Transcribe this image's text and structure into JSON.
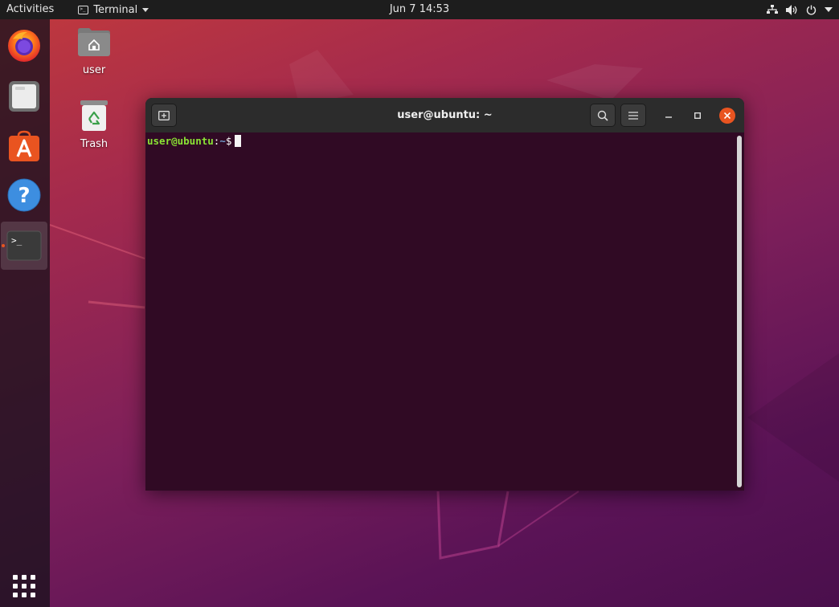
{
  "topbar": {
    "activities": "Activities",
    "app_menu_label": "Terminal",
    "clock": "Jun 7  14:53",
    "tray_icons": [
      "network-icon",
      "volume-icon",
      "power-icon",
      "chevron-down-icon"
    ]
  },
  "dock": {
    "items": [
      {
        "name": "firefox",
        "icon": "firefox-icon"
      },
      {
        "name": "files",
        "icon": "files-icon"
      },
      {
        "name": "ubuntu-software",
        "icon": "software-icon"
      },
      {
        "name": "help",
        "icon": "help-icon"
      },
      {
        "name": "terminal",
        "icon": "terminal-icon",
        "active": true
      }
    ],
    "show_apps_icon": "grid-icon"
  },
  "desktop": {
    "icons": [
      {
        "label": "user",
        "icon": "home-folder-icon"
      },
      {
        "label": "Trash",
        "icon": "trash-icon"
      }
    ]
  },
  "terminal": {
    "title": "user@ubuntu: ~",
    "prompt_user": "user@ubuntu",
    "prompt_sep": ":",
    "prompt_path": "~",
    "prompt_symbol": "$"
  },
  "colors": {
    "accent": "#e95420",
    "terminal_bg": "#300a24",
    "prompt_user": "#8ae234",
    "prompt_path": "#729fcf"
  }
}
